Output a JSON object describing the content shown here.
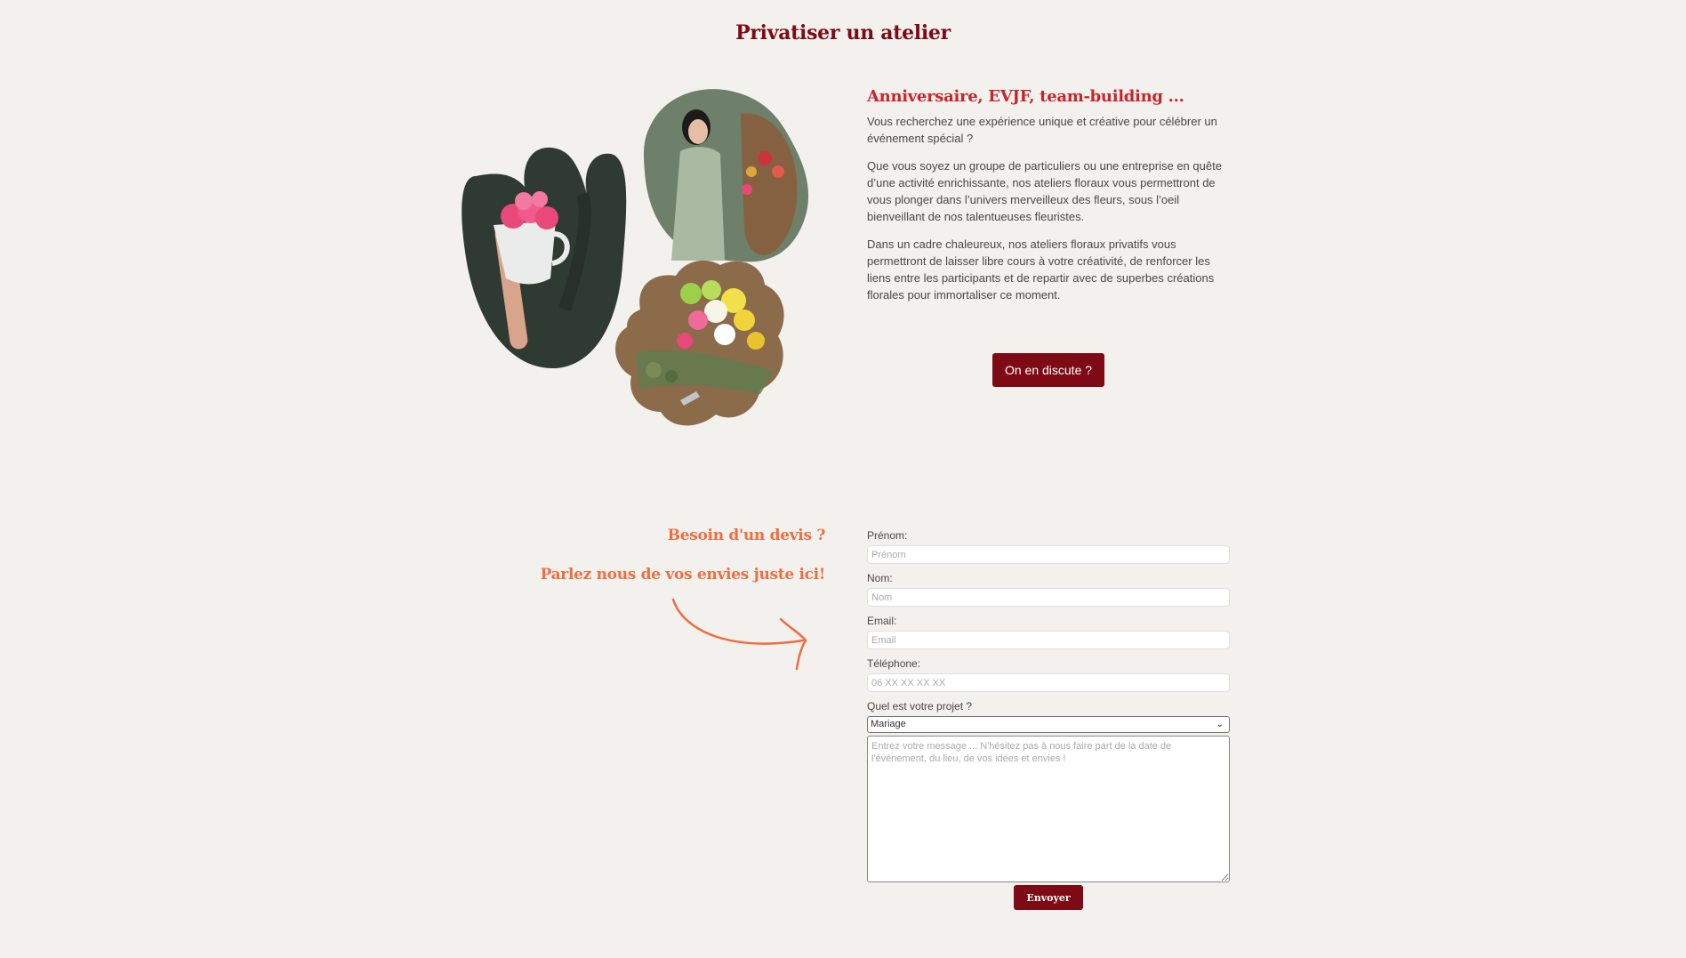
{
  "header": {
    "title": "Privatiser un atelier"
  },
  "intro": {
    "title": "Anniversaire, EVJF, team-building ...",
    "p1": "Vous recherchez une expérience unique et créative pour célébrer un événement spécial ?",
    "p2": "Que vous soyez un groupe de particuliers ou une entreprise en quête d’une activité enrichissante, nos ateliers floraux vous permettront de vous plonger dans l’univers merveilleux des fleurs, sous l’oeil bienveillant de nos talentueuses fleuristes.",
    "p3": "Dans un cadre chaleureux, nos ateliers floraux privatifs vous permettront de laisser libre cours à votre créativité,  de renforcer les liens entre les participants et de repartir avec de superbes créations florales pour immortaliser ce moment.",
    "cta_label": "On en discute ?"
  },
  "quote": {
    "title": "Besoin d'un devis ?",
    "subtitle": "Parlez nous de vos envies juste ici!"
  },
  "form": {
    "prenom_label": "Prénom:",
    "prenom_placeholder": "Prénom",
    "nom_label": "Nom:",
    "nom_placeholder": "Nom",
    "email_label": "Email:",
    "email_placeholder": "Email",
    "tel_label": "Téléphone:",
    "tel_placeholder": "06 XX XX XX XX",
    "projet_label": "Quel est votre projet ?",
    "projet_selected": "Mariage",
    "message_placeholder": "Entrez votre message ... N'hésitez pas à nous faire part de la date de l'événement, du lieu, de vos idées et envies !",
    "send_label": "Envoyer"
  },
  "colors": {
    "brand": "#7d0a14",
    "accent_red": "#c8252b",
    "accent_orange": "#f06d3f",
    "background": "#f3f1ee"
  }
}
